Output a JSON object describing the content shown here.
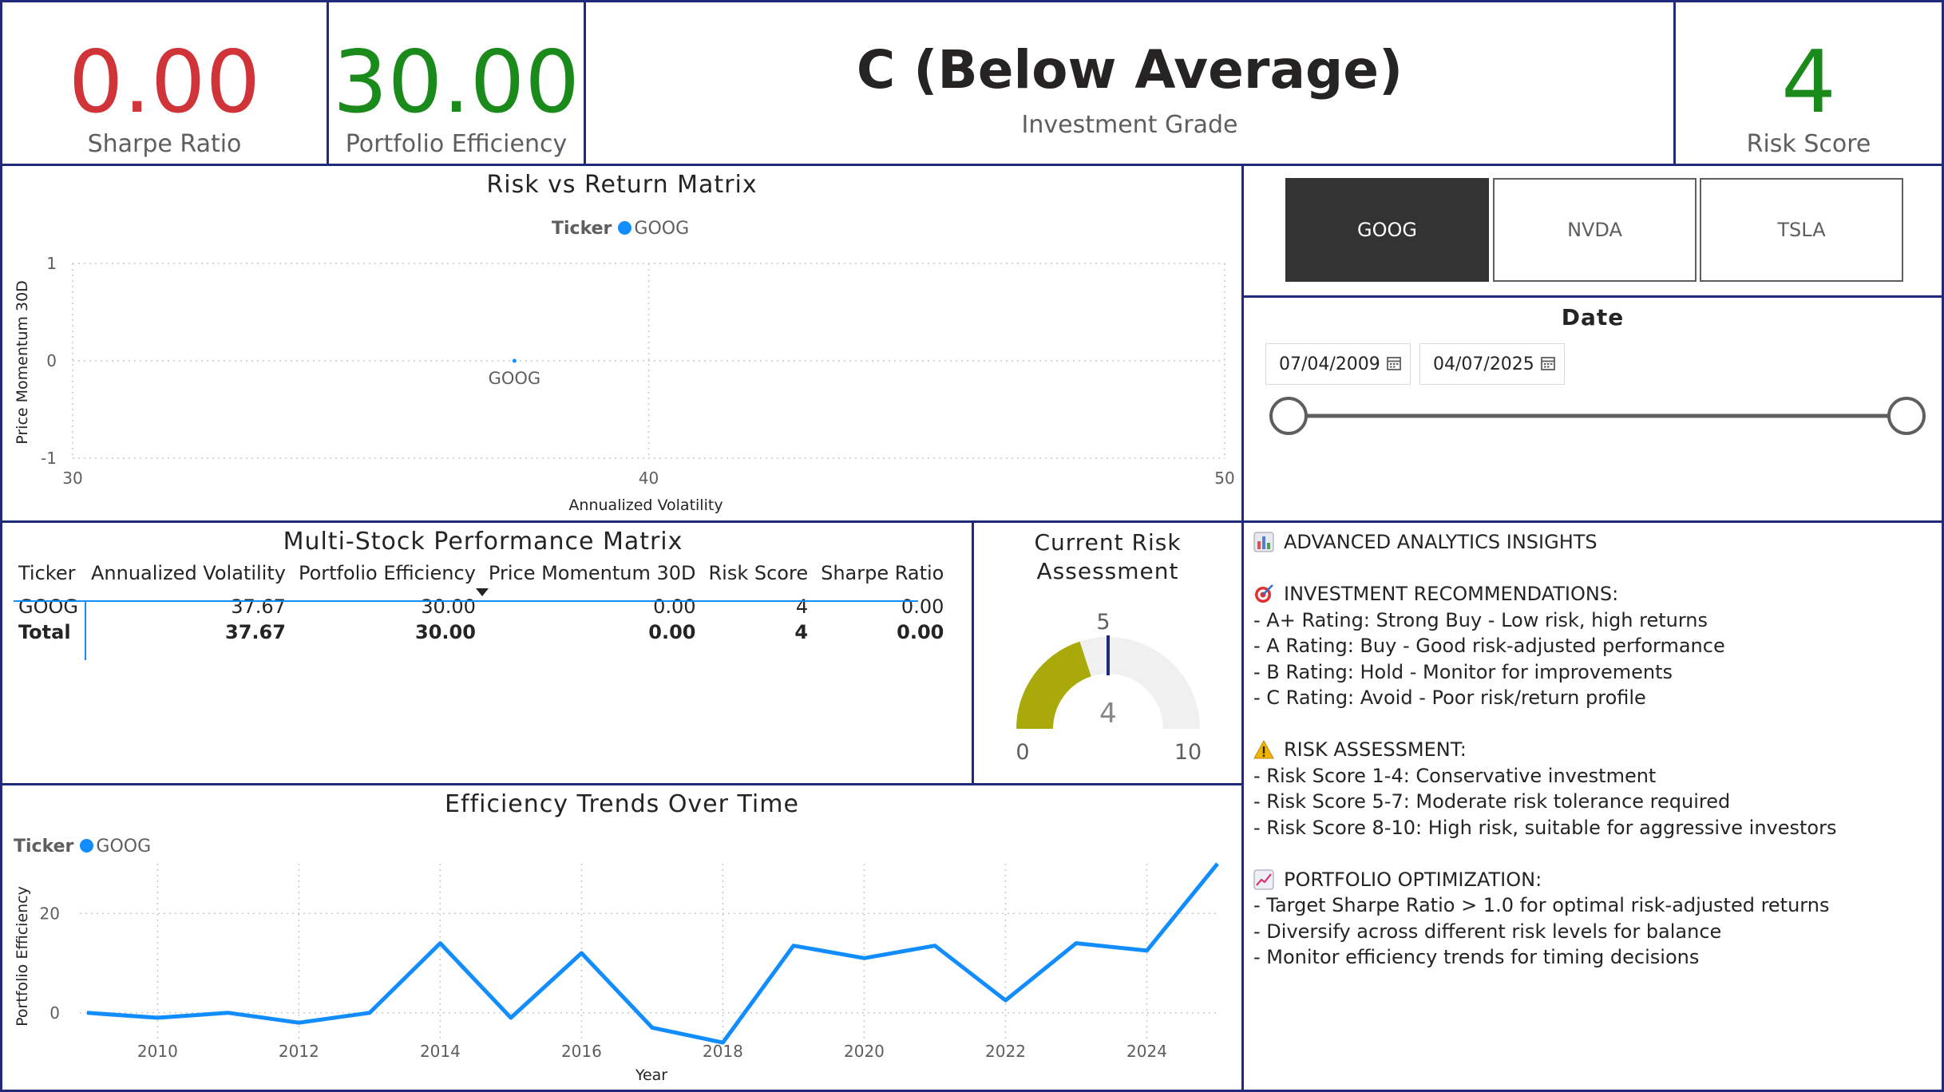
{
  "cards": {
    "sharpe": {
      "value": "0.00",
      "label": "Sharpe Ratio",
      "color": "#d13438"
    },
    "efficiency": {
      "value": "30.00",
      "label": "Portfolio Efficiency",
      "color": "#1a8a1a"
    },
    "grade": {
      "value": "C (Below Average)",
      "label": "Investment Grade"
    },
    "risk": {
      "value": "4",
      "label": "Risk Score",
      "color": "#1a8a1a"
    }
  },
  "scatter": {
    "title": "Risk vs Return Matrix",
    "legend_title": "Ticker",
    "legend_item": "GOOG",
    "point_label": "GOOG",
    "xlabel": "Annualized Volatility",
    "ylabel": "Price Momentum 30D",
    "xticks": [
      "30",
      "40",
      "50"
    ],
    "yticks": [
      "1",
      "0",
      "-1"
    ]
  },
  "matrix": {
    "title": "Multi-Stock Performance Matrix",
    "columns": [
      "Ticker",
      "Annualized Volatility",
      "Portfolio Efficiency",
      "Price Momentum 30D",
      "Risk Score",
      "Sharpe Ratio"
    ],
    "rows": [
      [
        "GOOG",
        "37.67",
        "30.00",
        "0.00",
        "4",
        "0.00"
      ]
    ],
    "total": [
      "Total",
      "37.67",
      "30.00",
      "0.00",
      "4",
      "0.00"
    ]
  },
  "gauge": {
    "title_line1": "Current Risk",
    "title_line2": "Assessment",
    "target_label": "5",
    "value_label": "4",
    "min_label": "0",
    "max_label": "10"
  },
  "line": {
    "title": "Efficiency Trends Over Time",
    "legend_title": "Ticker",
    "legend_item": "GOOG",
    "xlabel": "Year",
    "ylabel": "Portfolio Efficiency",
    "xticks": [
      "2010",
      "2012",
      "2014",
      "2016",
      "2018",
      "2020",
      "2022",
      "2024"
    ],
    "yticks": [
      "20",
      "0"
    ]
  },
  "slicer": {
    "tickers": [
      "GOOG",
      "NVDA",
      "TSLA"
    ],
    "selected": "GOOG"
  },
  "date": {
    "title": "Date",
    "start": "07/04/2009",
    "end": "04/07/2025"
  },
  "insights": {
    "lines": [
      {
        "icon": "bar-chart-icon",
        "text": "ADVANCED ANALYTICS INSIGHTS"
      },
      {
        "icon": "",
        "text": ""
      },
      {
        "icon": "target-icon",
        "text": "INVESTMENT RECOMMENDATIONS:"
      },
      {
        "icon": "",
        "text": "- A+ Rating: Strong Buy - Low risk, high returns"
      },
      {
        "icon": "",
        "text": "- A Rating: Buy - Good risk-adjusted performance"
      },
      {
        "icon": "",
        "text": "- B Rating: Hold - Monitor for improvements"
      },
      {
        "icon": "",
        "text": "- C Rating: Avoid - Poor risk/return profile"
      },
      {
        "icon": "",
        "text": ""
      },
      {
        "icon": "warning-icon",
        "text": "RISK ASSESSMENT:"
      },
      {
        "icon": "",
        "text": "- Risk Score 1-4: Conservative investment"
      },
      {
        "icon": "",
        "text": "- Risk Score 5-7: Moderate risk tolerance required"
      },
      {
        "icon": "",
        "text": "- Risk Score 8-10: High risk, suitable for aggressive investors"
      },
      {
        "icon": "",
        "text": ""
      },
      {
        "icon": "chart-increasing-icon",
        "text": "PORTFOLIO OPTIMIZATION:"
      },
      {
        "icon": "",
        "text": "- Target Sharpe Ratio > 1.0 for optimal risk-adjusted returns"
      },
      {
        "icon": "",
        "text": "- Diversify across different risk levels for balance"
      },
      {
        "icon": "",
        "text": "- Monitor efficiency trends for timing decisions"
      }
    ]
  },
  "colors": {
    "border": "#1f2a7a",
    "series": "#118dff",
    "gauge_fill": "#a9a90a",
    "gauge_bg": "#f0f0f0",
    "gauge_target": "#1f2a7a"
  },
  "chart_data": [
    {
      "type": "scatter",
      "title": "Risk vs Return Matrix",
      "xlabel": "Annualized Volatility",
      "ylabel": "Price Momentum 30D",
      "xlim": [
        30,
        50
      ],
      "ylim": [
        -1,
        1
      ],
      "series": [
        {
          "name": "GOOG",
          "points": [
            {
              "x": 37.67,
              "y": 0,
              "label": "GOOG"
            }
          ]
        }
      ],
      "legend": "top-center",
      "grid": true
    },
    {
      "type": "line",
      "title": "Efficiency Trends Over Time",
      "xlabel": "Year",
      "ylabel": "Portfolio Efficiency",
      "xlim": [
        2008.9,
        2025
      ],
      "ylim": [
        -10,
        30
      ],
      "series": [
        {
          "name": "GOOG",
          "x": [
            2009,
            2010,
            2011,
            2012,
            2013,
            2014,
            2015,
            2016,
            2017,
            2018,
            2019,
            2020,
            2021,
            2022,
            2023,
            2024,
            2025
          ],
          "values": [
            0,
            -1,
            0,
            -2,
            0,
            14,
            -1,
            12,
            -3,
            -6,
            13.5,
            11,
            13.5,
            2.5,
            14,
            12.5,
            30
          ]
        }
      ],
      "legend": "top-left",
      "grid": true
    },
    {
      "type": "gauge",
      "title": "Current Risk Assessment",
      "value": 4,
      "min": 0,
      "max": 10,
      "target": 5
    }
  ]
}
